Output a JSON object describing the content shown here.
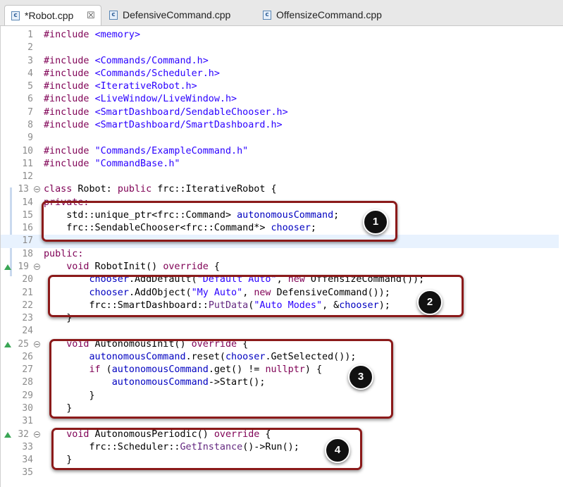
{
  "tabs": [
    {
      "label": "*Robot.cpp",
      "icon": "c-source-file-icon",
      "active": true,
      "closable": true
    },
    {
      "label": "DefensiveCommand.cpp",
      "icon": "c-source-file-icon",
      "active": false
    },
    {
      "label": "OffensizeCommand.cpp",
      "icon": "c-source-file-icon",
      "active": false
    }
  ],
  "file_icon_glyph": "c",
  "close_glyph": "☒",
  "colors": {
    "keyword": "#7f0055",
    "string": "#2a00ff",
    "field": "#0000c0",
    "method": "#642880",
    "annotation_box": "#8b1a1a",
    "current_line": "#e8f2fe",
    "override_marker": "#3aa655"
  },
  "lines": [
    {
      "n": "1"
    },
    {
      "n": "2"
    },
    {
      "n": "3"
    },
    {
      "n": "4"
    },
    {
      "n": "5"
    },
    {
      "n": "6"
    },
    {
      "n": "7"
    },
    {
      "n": "8"
    },
    {
      "n": "9"
    },
    {
      "n": "10"
    },
    {
      "n": "11"
    },
    {
      "n": "12"
    },
    {
      "n": "13"
    },
    {
      "n": "14"
    },
    {
      "n": "15"
    },
    {
      "n": "16"
    },
    {
      "n": "17"
    },
    {
      "n": "18"
    },
    {
      "n": "19"
    },
    {
      "n": "20"
    },
    {
      "n": "21"
    },
    {
      "n": "22"
    },
    {
      "n": "23"
    },
    {
      "n": "24"
    },
    {
      "n": "25"
    },
    {
      "n": "26"
    },
    {
      "n": "27"
    },
    {
      "n": "28"
    },
    {
      "n": "29"
    },
    {
      "n": "30"
    },
    {
      "n": "31"
    },
    {
      "n": "32"
    },
    {
      "n": "33"
    },
    {
      "n": "34"
    },
    {
      "n": "35"
    }
  ],
  "code": {
    "include": "#include",
    "memory": "<memory>",
    "cmd_h": "<Commands/Command.h>",
    "sched_h": "<Commands/Scheduler.h>",
    "iter_h": "<IterativeRobot.h>",
    "lw_h": "<LiveWindow/LiveWindow.h>",
    "sc_h": "<SmartDashboard/SendableChooser.h>",
    "sd_h": "<SmartDashboard/SmartDashboard.h>",
    "ex_h": "\"Commands/ExampleCommand.h\"",
    "cb_h": "\"CommandBase.h\"",
    "class": "class",
    "robot_decl": " Robot: ",
    "public": "public",
    "iterrobot": " frc::IterativeRobot {",
    "private": "private:",
    "l15a": "std::unique_ptr<frc::Command> ",
    "autonomousCommand": "autonomousCommand",
    "semi": ";",
    "l16a": "frc::SendableChooser<frc::Command*> ",
    "chooser": "chooser",
    "public_colon": "public:",
    "void": "void",
    "override": "override",
    "robotinit": " RobotInit() ",
    "brace_open": " {",
    "adddefault": ".AddDefault(",
    "default_auto": "\"Default Auto\"",
    "comma": ", ",
    "new": "new",
    "offcmd": " OffensizeCommand());",
    "addobject": ".AddObject(",
    "my_auto": "\"My Auto\"",
    "defcmd": " DefensiveCommand());",
    "sdscope": "frc::SmartDashboard::",
    "putdata": "PutData",
    "paren_open": "(",
    "auto_modes": "\"Auto Modes\"",
    "amp": ", &",
    "close_paren_semi": ");",
    "brace_close": "}",
    "autoinit": " AutonomousInit() ",
    "reset": ".reset(",
    "getselected": ".GetSelected());",
    "if": "if",
    "if_open": " (",
    "get_ne": ".get() != ",
    "nullptr": "nullptr",
    "if_close": ") {",
    "start_call": "->Start();",
    "autoperiodic": " AutonomousPeriodic() ",
    "schedscope": "frc::Scheduler::",
    "getinstance": "GetInstance",
    "run_call": "()->Run();"
  },
  "annotations": [
    "1",
    "2",
    "3",
    "4"
  ]
}
